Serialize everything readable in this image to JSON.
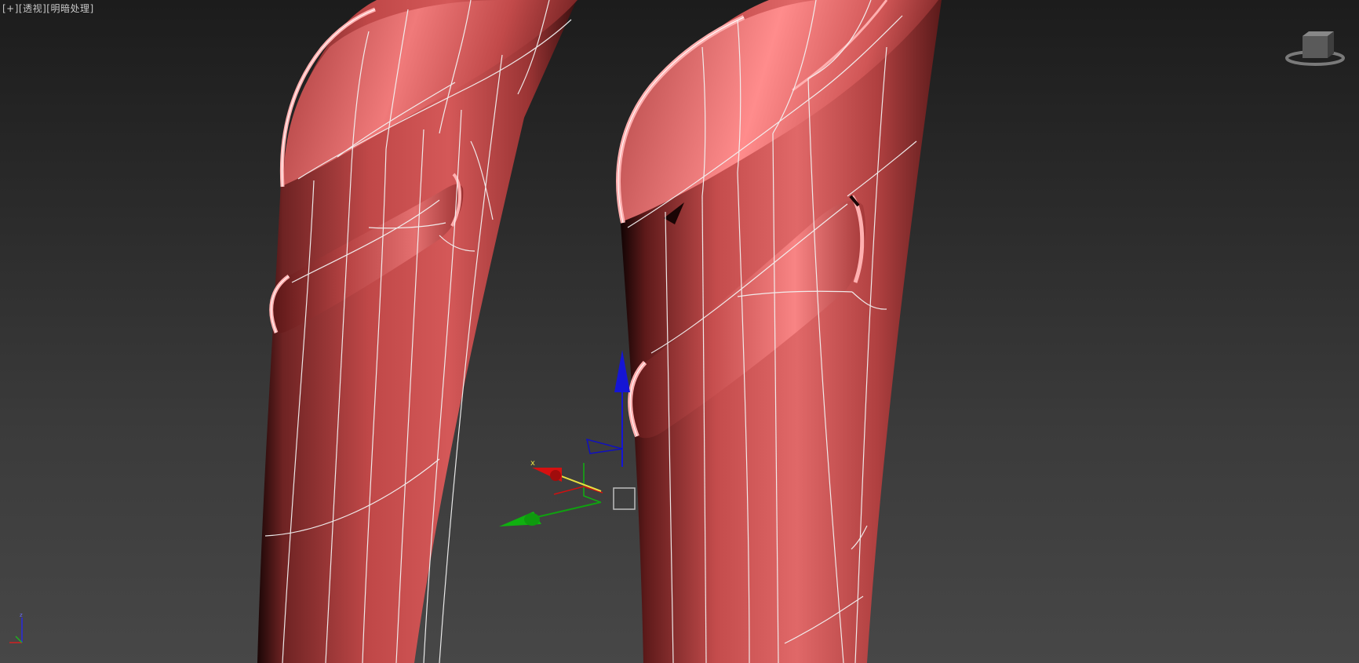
{
  "viewport": {
    "label_plus": "[+]",
    "label_view": "[透视]",
    "label_shading": "[明暗处理]"
  },
  "gizmo": {
    "x_label": "x"
  },
  "colors": {
    "model_base": "#c24a4a",
    "model_highlight": "#ff8c8c",
    "model_shadow": "#6e2020",
    "wire": "#f3f3f3",
    "axis_x": "#d01010",
    "axis_y": "#10b010",
    "axis_z": "#1010d0",
    "axis_yellow": "#e8e040"
  },
  "icons": {
    "viewcube": "home-viewcube-icon",
    "tripod": "world-axis-tripod-icon",
    "gizmo": "move-gizmo-icon"
  }
}
